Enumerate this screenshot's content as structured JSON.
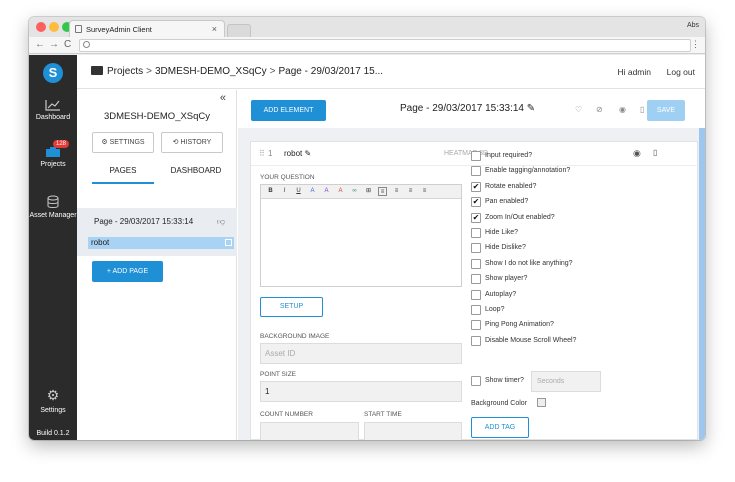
{
  "browser": {
    "tab_title": "SurveyAdmin Client",
    "tab_close": "×",
    "user_label": "Abs",
    "nav_back": "←",
    "nav_forward": "→",
    "nav_reload": "C",
    "menu": "⋮",
    "traffic_lights": [
      "#fc615d",
      "#fdbc40",
      "#34c84a"
    ]
  },
  "leftnav": {
    "logo": "S",
    "items": [
      {
        "label": "Dashboard",
        "icon": "chart-line-icon"
      },
      {
        "label": "Projects",
        "icon": "projects-icon",
        "badge": "128"
      },
      {
        "label": "Asset Manager",
        "icon": "database-icon"
      },
      {
        "label": "Settings",
        "icon": "gear-icon"
      }
    ],
    "build": "Build 0.1.2"
  },
  "topbar": {
    "breadcrumb": [
      "Projects",
      "3DMESH-DEMO_XSqCy",
      "Page - 29/03/2017 15..."
    ],
    "sep": ">",
    "greeting": "Hi admin",
    "logout": "Log out"
  },
  "project": {
    "collapse": "«",
    "title": "3DMESH-DEMO_XSqCy",
    "settings_btn": "⚙ SETTINGS",
    "history_btn": "⟲ HISTORY",
    "tabs": [
      "PAGES",
      "DASHBOARD"
    ],
    "page_item": "Page - 29/03/2017 15:33:14",
    "element_item": "robot",
    "add_page": "+ ADD PAGE"
  },
  "main": {
    "add_element": "ADD ELEMENT",
    "page_title": "Page - 29/03/2017 15:33:14",
    "save": "SAVE",
    "accent": "#1f8fd6"
  },
  "element": {
    "index": "1",
    "name": "robot",
    "type": "HEATMAP 3D",
    "your_question_label": "YOUR QUESTION",
    "toolbar": [
      "B",
      "I",
      "U",
      "A",
      "A",
      "A",
      "∞",
      "⊞",
      "≡",
      "≡",
      "≡",
      "≡"
    ],
    "setup": "SETUP",
    "bg_image_label": "BACKGROUND IMAGE",
    "bg_image_placeholder": "Asset ID",
    "point_size_label": "POINT SIZE",
    "point_size_value": "1",
    "count_number_label": "COUNT NUMBER",
    "start_time_label": "START TIME",
    "options": [
      {
        "label": "Input required?",
        "checked": false
      },
      {
        "label": "Enable tagging/annotation?",
        "checked": false
      },
      {
        "label": "Rotate enabled?",
        "checked": true
      },
      {
        "label": "Pan enabled?",
        "checked": true
      },
      {
        "label": "Zoom In/Out enabled?",
        "checked": true
      },
      {
        "label": "Hide Like?",
        "checked": false
      },
      {
        "label": "Hide Dislike?",
        "checked": false
      },
      {
        "label": "Show I do not like anything?",
        "checked": false
      },
      {
        "label": "Show player?",
        "checked": false
      },
      {
        "label": "Autoplay?",
        "checked": false
      },
      {
        "label": "Loop?",
        "checked": false
      },
      {
        "label": "Ping Pong Animation?",
        "checked": false
      },
      {
        "label": "Disable Mouse Scroll Wheel?",
        "checked": false
      }
    ],
    "show_timer_label": "Show timer?",
    "seconds_placeholder": "Seconds",
    "background_color_label": "Background Color",
    "add_tag": "ADD TAG"
  }
}
